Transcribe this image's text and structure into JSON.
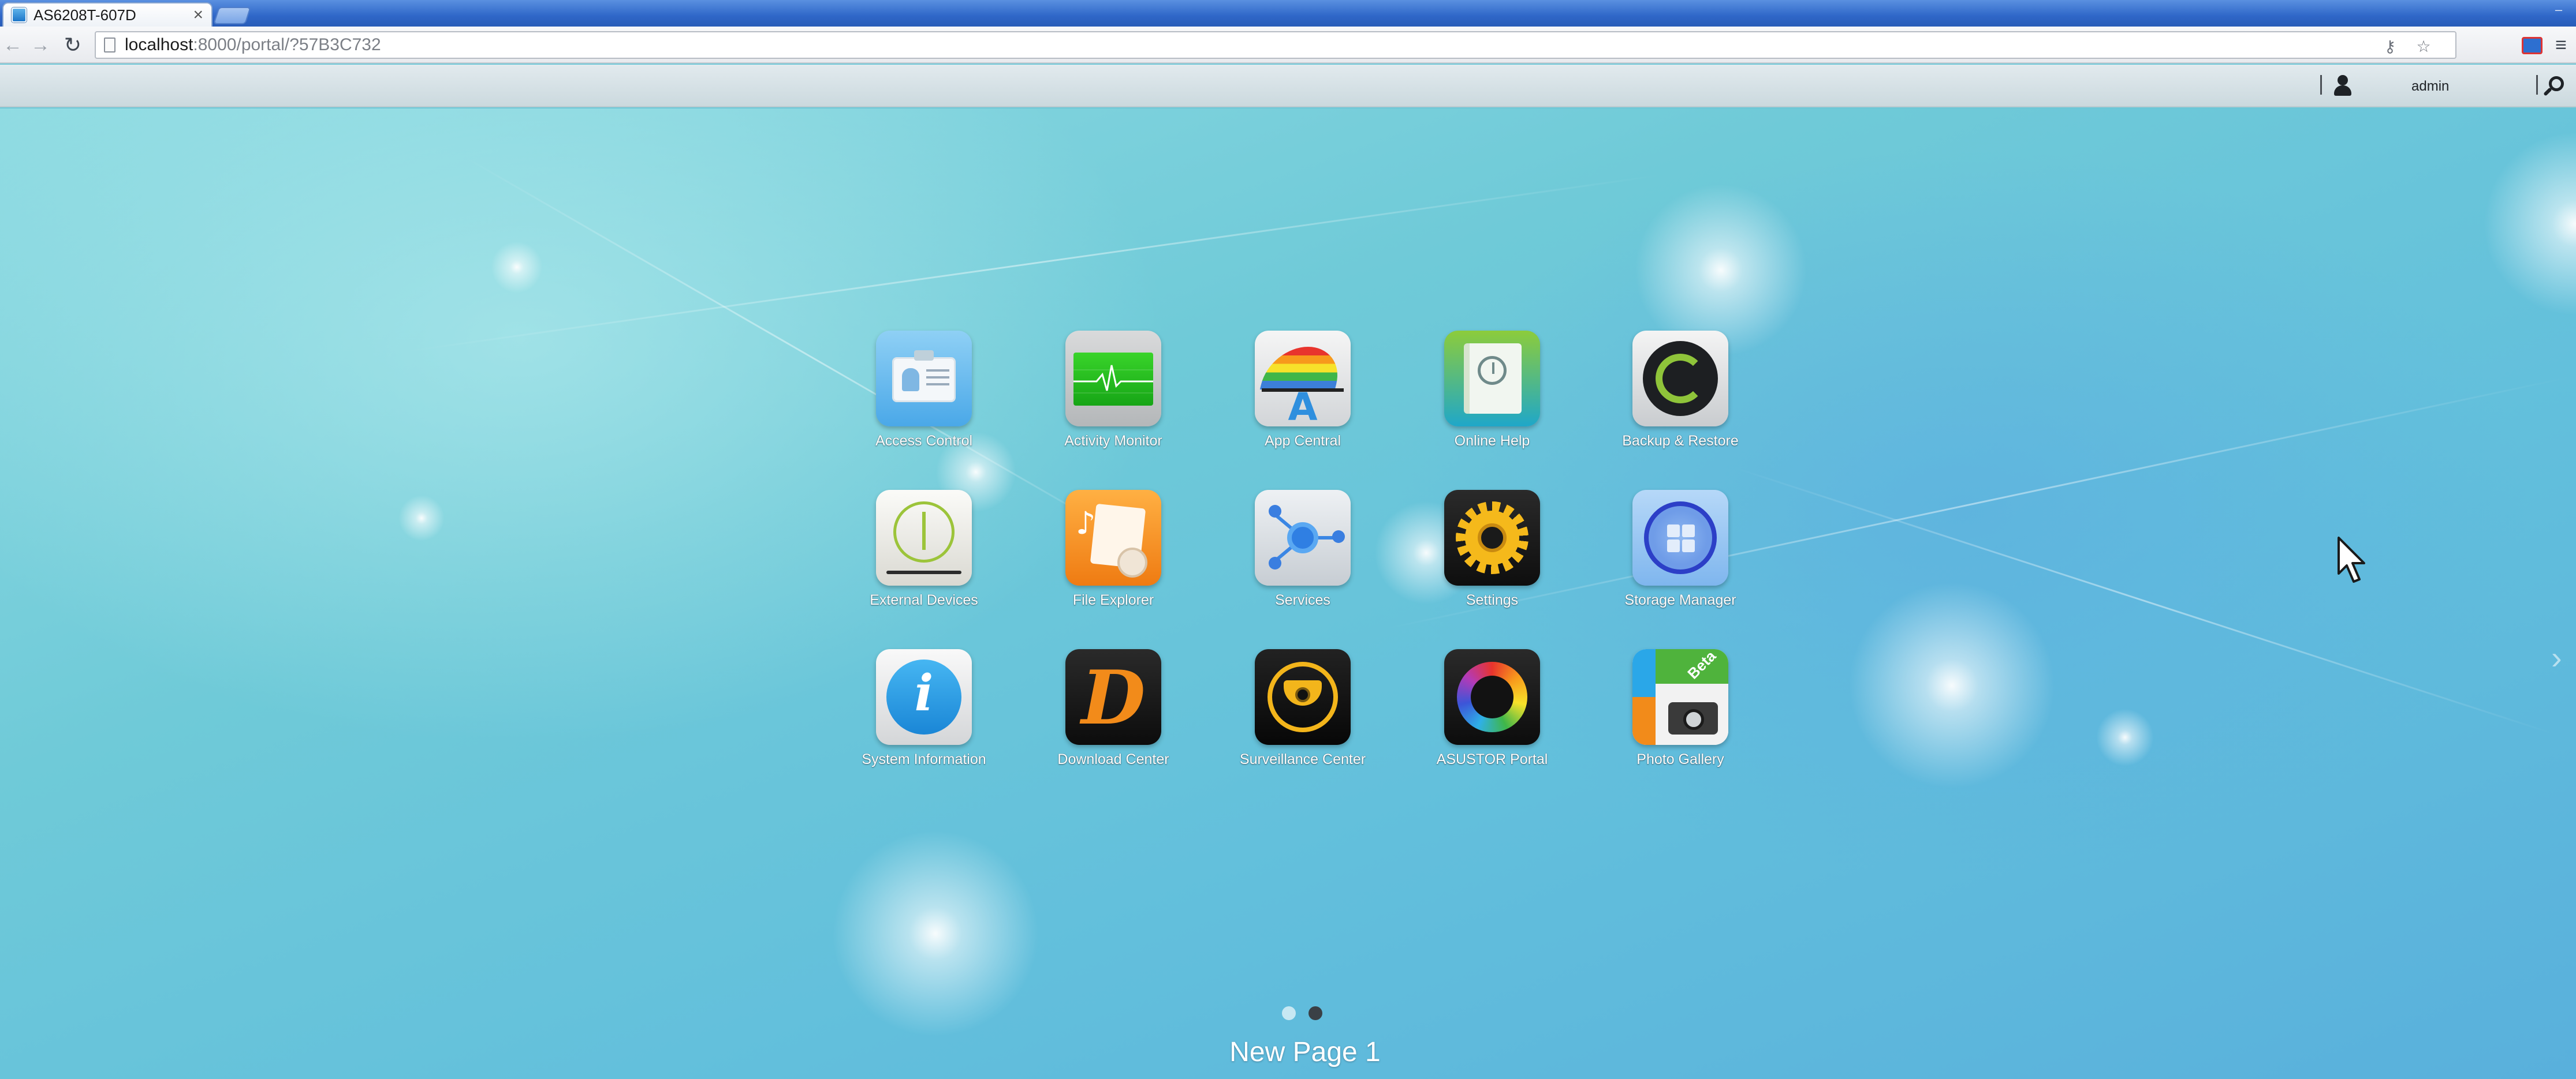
{
  "browser": {
    "tab_title": "AS6208T-607D",
    "tab_close_glyph": "×",
    "url_host": "localhost",
    "url_path": ":8000/portal/?57B3C732"
  },
  "portal_bar": {
    "username": "admin"
  },
  "apps": [
    {
      "label": "Access Control",
      "icon": "access-control-icon"
    },
    {
      "label": "Activity Monitor",
      "icon": "activity-monitor-icon"
    },
    {
      "label": "App Central",
      "icon": "app-central-icon"
    },
    {
      "label": "Online Help",
      "icon": "online-help-icon"
    },
    {
      "label": "Backup & Restore",
      "icon": "backup-restore-icon"
    },
    {
      "label": "External Devices",
      "icon": "external-devices-icon"
    },
    {
      "label": "File Explorer",
      "icon": "file-explorer-icon"
    },
    {
      "label": "Services",
      "icon": "services-icon"
    },
    {
      "label": "Settings",
      "icon": "settings-icon"
    },
    {
      "label": "Storage Manager",
      "icon": "storage-manager-icon"
    },
    {
      "label": "System Information",
      "icon": "system-information-icon"
    },
    {
      "label": "Download Center",
      "icon": "download-center-icon"
    },
    {
      "label": "Surveillance Center",
      "icon": "surveillance-center-icon"
    },
    {
      "label": "ASUSTOR Portal",
      "icon": "asustor-portal-icon"
    },
    {
      "label": "Photo Gallery",
      "icon": "photo-gallery-icon",
      "badge": "Beta"
    }
  ],
  "app_icon_glyphs": {
    "app_central_letter": "A",
    "system_info_letter": "i",
    "download_center_letter": "D",
    "file_explorer_note": "♪"
  },
  "pager": {
    "current_page": 2,
    "total_pages": 2,
    "page_name": "New Page 1"
  },
  "colors": {
    "desktop_background": "#6cc6d6",
    "title_bar": "#2f67c8"
  }
}
